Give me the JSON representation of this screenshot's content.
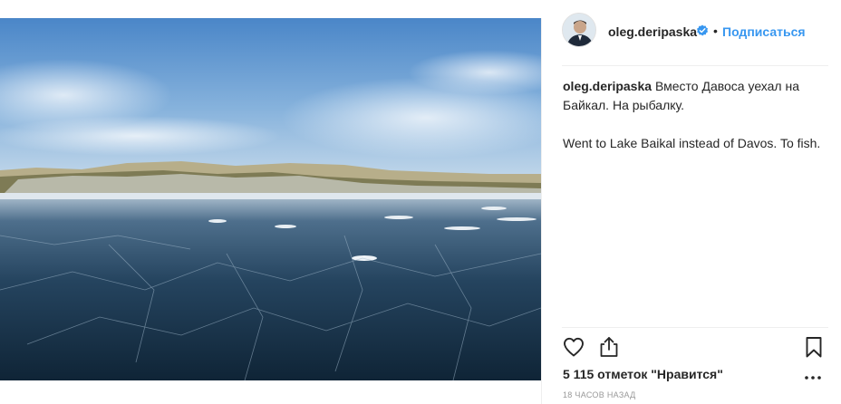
{
  "header": {
    "username": "oleg.deripaska",
    "separator": "•",
    "follow_label": "Подписаться"
  },
  "caption": {
    "username": "oleg.deripaska",
    "text_ru": "Вместо Давоса уехал на Байкал. На рыбалку.",
    "text_en": "Went to Lake Baikal instead of Davos. To fish."
  },
  "actions": {
    "like_icon": "heart-outline-icon",
    "share_icon": "share-icon",
    "save_icon": "bookmark-icon",
    "more_icon": "more-icon"
  },
  "stats": {
    "likes_label": "5 115 отметок \"Нравится\"",
    "time_label": "18 ЧАСОВ НАЗАД"
  },
  "colors": {
    "link": "#3897f0",
    "text": "#262626",
    "muted": "#999999",
    "verified": "#3897f0"
  }
}
